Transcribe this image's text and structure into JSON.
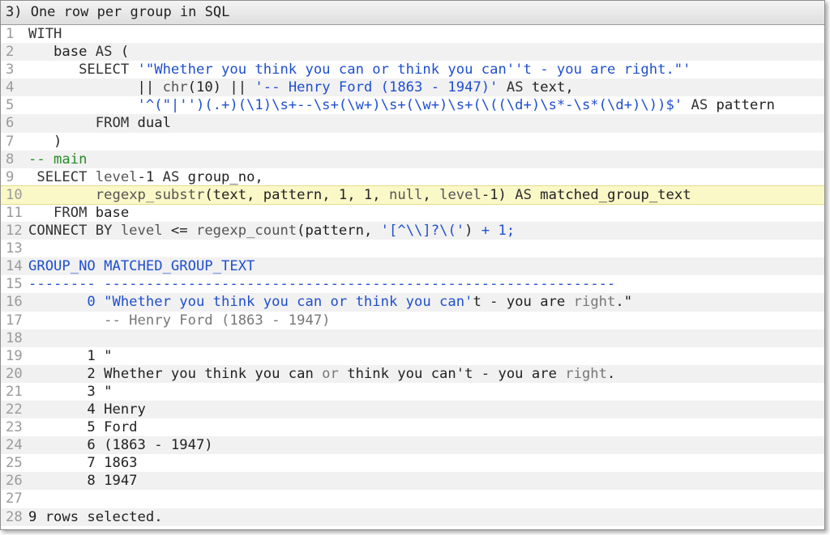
{
  "window": {
    "title": "3) One row per group in SQL"
  },
  "lines": [
    {
      "n": "1",
      "segments": [
        {
          "t": "WITH",
          "c": "kw"
        }
      ]
    },
    {
      "n": "2",
      "segments": [
        {
          "t": "   base ",
          "c": ""
        },
        {
          "t": "AS",
          "c": "kw"
        },
        {
          "t": " (",
          "c": ""
        }
      ]
    },
    {
      "n": "3",
      "segments": [
        {
          "t": "      SELECT ",
          "c": "kw"
        },
        {
          "t": "'\"Whether you think you can or think you can''t - you are right.\"'",
          "c": "str"
        }
      ]
    },
    {
      "n": "4",
      "segments": [
        {
          "t": "             || ",
          "c": ""
        },
        {
          "t": "chr",
          "c": "fn"
        },
        {
          "t": "(10) || ",
          "c": ""
        },
        {
          "t": "'-- Henry Ford (1863 - 1947)'",
          "c": "str"
        },
        {
          "t": " AS ",
          "c": "kw"
        },
        {
          "t": "text,",
          "c": ""
        }
      ]
    },
    {
      "n": "5",
      "segments": [
        {
          "t": "             ",
          "c": ""
        },
        {
          "t": "'^(\"|'')(.+)(\\1)\\s+--\\s+(\\w+)\\s+(\\w+)\\s+(\\((\\d+)\\s*-\\s*(\\d+)\\))$'",
          "c": "str"
        },
        {
          "t": " AS ",
          "c": "kw"
        },
        {
          "t": "pattern",
          "c": ""
        }
      ]
    },
    {
      "n": "6",
      "segments": [
        {
          "t": "        FROM ",
          "c": "kw"
        },
        {
          "t": "dual",
          "c": ""
        }
      ]
    },
    {
      "n": "7",
      "segments": [
        {
          "t": "   )",
          "c": ""
        }
      ]
    },
    {
      "n": "8",
      "segments": [
        {
          "t": "-- main",
          "c": "cm"
        }
      ]
    },
    {
      "n": "9",
      "segments": [
        {
          "t": " SELECT ",
          "c": "kw"
        },
        {
          "t": "level",
          "c": "fn"
        },
        {
          "t": "-1 ",
          "c": ""
        },
        {
          "t": "AS",
          "c": "kw"
        },
        {
          "t": " group_no,",
          "c": ""
        }
      ]
    },
    {
      "n": "10",
      "hl": true,
      "segments": [
        {
          "t": "        ",
          "c": ""
        },
        {
          "t": "regexp_substr",
          "c": "fn"
        },
        {
          "t": "(text, pattern, 1, 1, ",
          "c": ""
        },
        {
          "t": "null",
          "c": "fn"
        },
        {
          "t": ", ",
          "c": ""
        },
        {
          "t": "level",
          "c": "fn"
        },
        {
          "t": "-1) ",
          "c": ""
        },
        {
          "t": "AS",
          "c": "kw"
        },
        {
          "t": " matched_group_text",
          "c": ""
        }
      ]
    },
    {
      "n": "11",
      "segments": [
        {
          "t": "   FROM ",
          "c": "kw"
        },
        {
          "t": "base",
          "c": ""
        }
      ]
    },
    {
      "n": "12",
      "segments": [
        {
          "t": "CONNECT BY ",
          "c": "kw"
        },
        {
          "t": "level",
          "c": "fn"
        },
        {
          "t": " <= ",
          "c": ""
        },
        {
          "t": "regexp_count",
          "c": "fn"
        },
        {
          "t": "(pattern, ",
          "c": ""
        },
        {
          "t": "'[^\\\\]?\\('",
          "c": "str"
        },
        {
          "t": ") ",
          "c": ""
        },
        {
          "t": "+ 1;",
          "c": "blue"
        }
      ]
    },
    {
      "n": "13",
      "segments": []
    },
    {
      "n": "14",
      "segments": [
        {
          "t": "GROUP_NO MATCHED_GROUP_TEXT",
          "c": "blue"
        }
      ]
    },
    {
      "n": "15",
      "segments": [
        {
          "t": "-------- -------------------------------------------------------------",
          "c": "blue"
        }
      ]
    },
    {
      "n": "16",
      "segments": [
        {
          "t": "       0 ",
          "c": "blue"
        },
        {
          "t": "\"Whether you think you can or think you can'",
          "c": "blue"
        },
        {
          "t": "t - you are ",
          "c": ""
        },
        {
          "t": "right",
          "c": "dim"
        },
        {
          "t": ".\"",
          "c": ""
        }
      ]
    },
    {
      "n": "17",
      "segments": [
        {
          "t": "         -- Henry Ford (1863 - 1947)",
          "c": "dim"
        }
      ]
    },
    {
      "n": "18",
      "segments": []
    },
    {
      "n": "19",
      "segments": [
        {
          "t": "       1 \"",
          "c": ""
        }
      ]
    },
    {
      "n": "20",
      "segments": [
        {
          "t": "       2 Whether you think you can ",
          "c": ""
        },
        {
          "t": "or",
          "c": "dim"
        },
        {
          "t": " think you can't - you are ",
          "c": ""
        },
        {
          "t": "right",
          "c": "dim"
        },
        {
          "t": ".",
          "c": ""
        }
      ]
    },
    {
      "n": "21",
      "segments": [
        {
          "t": "       3 \"",
          "c": ""
        }
      ]
    },
    {
      "n": "22",
      "segments": [
        {
          "t": "       4 Henry",
          "c": ""
        }
      ]
    },
    {
      "n": "23",
      "segments": [
        {
          "t": "       5 Ford",
          "c": ""
        }
      ]
    },
    {
      "n": "24",
      "segments": [
        {
          "t": "       6 (1863 - 1947)",
          "c": ""
        }
      ]
    },
    {
      "n": "25",
      "segments": [
        {
          "t": "       7 1863",
          "c": ""
        }
      ]
    },
    {
      "n": "26",
      "segments": [
        {
          "t": "       8 1947",
          "c": ""
        }
      ]
    },
    {
      "n": "27",
      "segments": []
    },
    {
      "n": "28",
      "segments": [
        {
          "t": "9 rows selected.",
          "c": ""
        }
      ]
    }
  ]
}
